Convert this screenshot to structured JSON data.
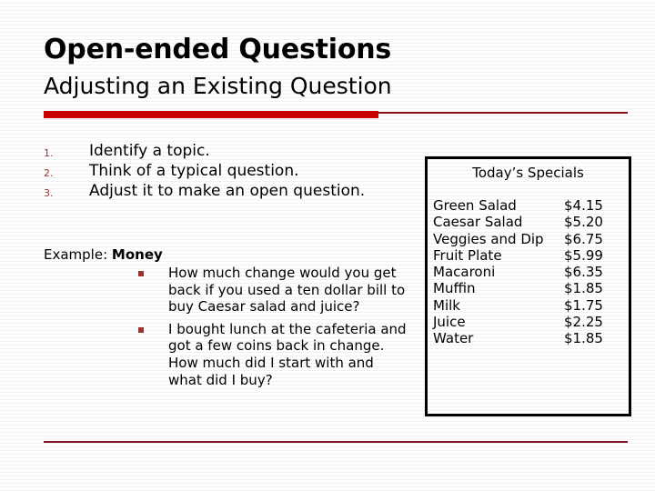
{
  "slide": {
    "title": "Open-ended Questions",
    "subtitle": "Adjusting an Existing Question"
  },
  "colors": {
    "rule_thick": "#c90000",
    "rule_thin": "#8c1212",
    "rule_bottom": "#7e1523",
    "marker": "#993333",
    "text": "#000000",
    "box_border": "#000000",
    "background": "#ffffff"
  },
  "steps": [
    {
      "marker": "1.",
      "text": "Identify a topic."
    },
    {
      "marker": "2.",
      "text": "Think of a typical question."
    },
    {
      "marker": "3.",
      "text": "Adjust it to make an open question."
    }
  ],
  "example": {
    "label": "Example:",
    "topic": "Money",
    "bullets": [
      "How much change would you get back if you used a ten dollar bill to buy Caesar salad and juice?",
      "I bought lunch at the cafeteria and got a few coins back in change. How much did I start with and what did I buy?"
    ]
  },
  "specials": {
    "title": "Today’s Specials",
    "items": [
      {
        "name": "Green Salad",
        "price": "$4.15"
      },
      {
        "name": "Caesar Salad",
        "price": "$5.20"
      },
      {
        "name": "Veggies and Dip",
        "price": "$6.75"
      },
      {
        "name": "Fruit Plate",
        "price": "$5.99"
      },
      {
        "name": "Macaroni",
        "price": "$6.35"
      },
      {
        "name": "Muffin",
        "price": "$1.85"
      },
      {
        "name": "Milk",
        "price": "$1.75"
      },
      {
        "name": "Juice",
        "price": "$2.25"
      },
      {
        "name": "Water",
        "price": "$1.85"
      }
    ]
  }
}
